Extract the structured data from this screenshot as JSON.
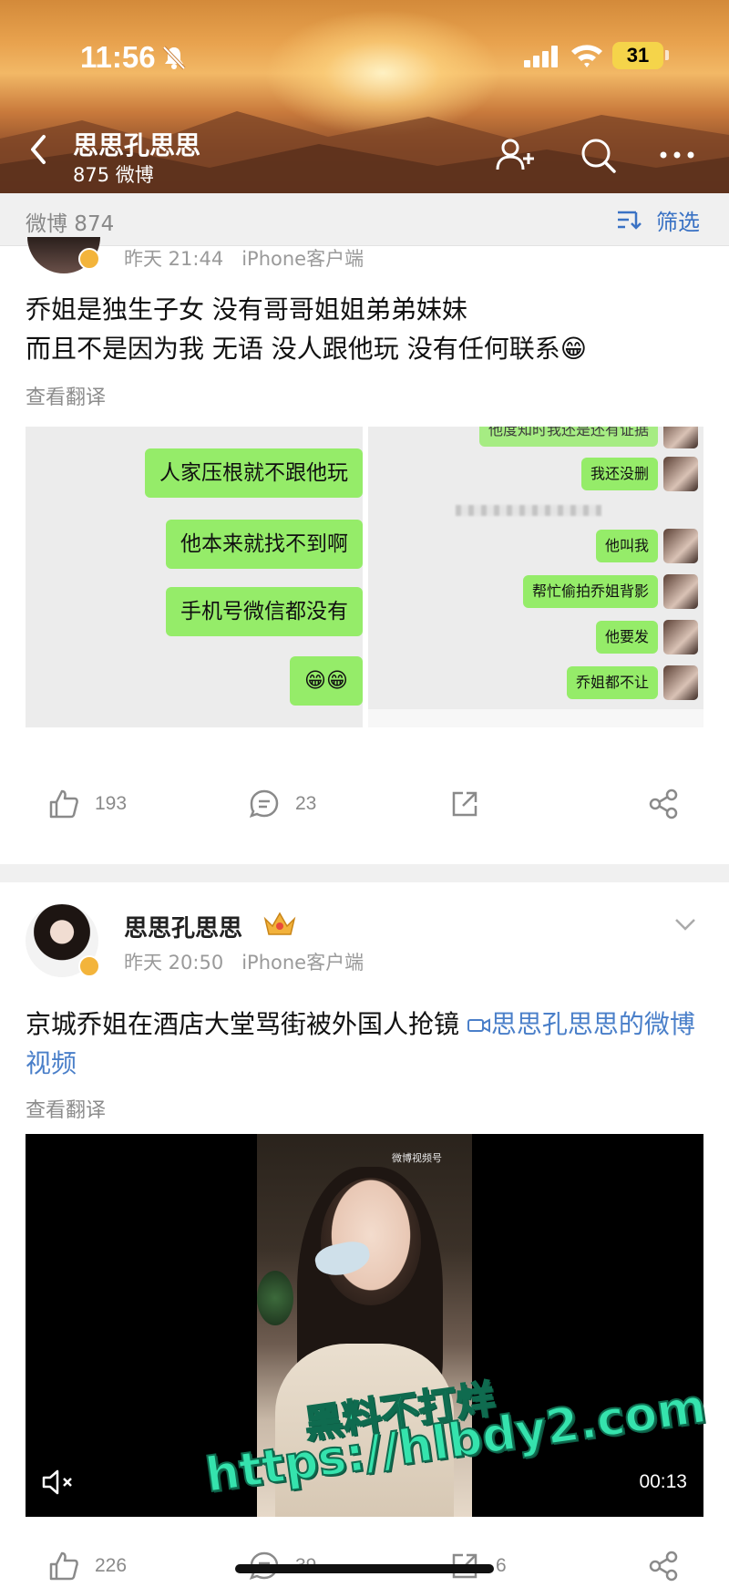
{
  "status_bar": {
    "time": "11:56",
    "battery": "31"
  },
  "nav": {
    "title": "思思孔思思",
    "subtitle": "875 微博"
  },
  "tabs": {
    "count_label": "微博 874",
    "filter_label": "筛选"
  },
  "posts": [
    {
      "meta": "昨天 21:44   iPhone客户端",
      "text_line1": "乔姐是独生子女 没有哥哥姐姐弟弟妹妹",
      "text_line2": "而且不是因为我 无语 没人跟他玩 没有任何联系😁",
      "translate": "查看翻译",
      "left_chat": [
        "人家压根就不跟他玩",
        "他本来就找不到啊",
        "手机号微信都没有",
        "😁😁"
      ],
      "right_chat": [
        "他度知时我还是还有证据",
        "我还没删",
        "他叫我",
        "帮忙偷拍乔姐背影",
        "他要发",
        "乔姐都不让"
      ],
      "likes": "193",
      "comments": "23"
    },
    {
      "author": "思思孔思思",
      "meta": "昨天 20:50   iPhone客户端",
      "text_main": "京城乔姐在酒店大堂骂街被外国人抢镜 ",
      "text_link": "思思孔思思的微博视频",
      "translate": "查看翻译",
      "video_duration": "00:13",
      "video_watermark": "微博视频号",
      "likes": "226",
      "comments": "39",
      "reposts": "6"
    }
  ],
  "watermark": {
    "line1": "黑料不打烊",
    "line2": "https://hlbdy2.com"
  }
}
